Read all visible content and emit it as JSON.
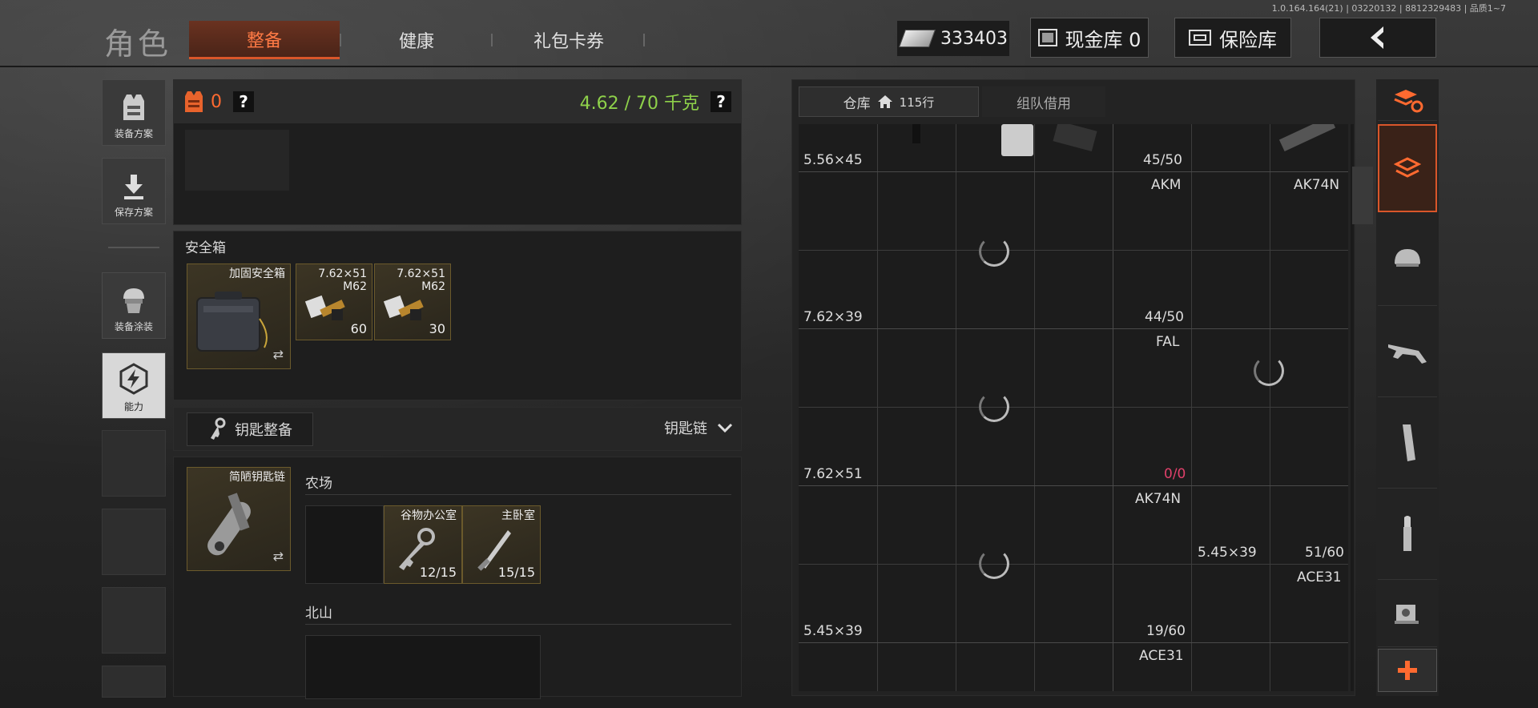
{
  "version": "1.0.164.164(21) | 03220132 | 8812329483 | 品质1~7",
  "header": {
    "title": "角色",
    "tabs": [
      "整备",
      "健康",
      "礼包卡券"
    ],
    "money": "333403",
    "cash_vault": "现金库 0",
    "safe_vault": "保险库"
  },
  "left_menu": {
    "loadout_plan": "装备方案",
    "save_plan": "保存方案",
    "skin": "装备涂装",
    "ability": "能力"
  },
  "loadout": {
    "armor_count": "0",
    "weight": "4.62 / 70 千克",
    "help": "?"
  },
  "safebox": {
    "title": "安全箱",
    "container_name": "加固安全箱",
    "items": [
      {
        "caliber": "7.62×51",
        "type": "M62",
        "count": "60"
      },
      {
        "caliber": "7.62×51",
        "type": "M62",
        "count": "30"
      }
    ]
  },
  "keys": {
    "button": "钥匙整备",
    "dropdown": "钥匙链",
    "chain_name": "简陋钥匙链",
    "sections": [
      {
        "name": "农场",
        "keys": [
          {
            "name": "谷物办公室",
            "count": "12/15"
          },
          {
            "name": "主卧室",
            "count": "15/15"
          }
        ]
      },
      {
        "name": "北山",
        "keys": []
      }
    ]
  },
  "warehouse": {
    "tab_storage": "仓库",
    "rows": "115行",
    "tab_team": "组队借用",
    "labels": [
      {
        "text": "5.56×45"
      },
      {
        "text": "45/50"
      },
      {
        "text": "AKM"
      },
      {
        "text": "AK74N"
      },
      {
        "text": "7.62×39"
      },
      {
        "text": "44/50"
      },
      {
        "text": "FAL"
      },
      {
        "text": "7.62×51"
      },
      {
        "text": "0/0"
      },
      {
        "text": "AK74N"
      },
      {
        "text": "5.45×39"
      },
      {
        "text": "51/60"
      },
      {
        "text": "ACE31"
      },
      {
        "text": "5.45×39"
      },
      {
        "text": "19/60"
      },
      {
        "text": "ACE31"
      }
    ]
  },
  "sidebar_icons": [
    "layers-refresh-icon",
    "stack-icon",
    "helmet-icon",
    "rifle-icon",
    "magazine-icon",
    "bullet-icon",
    "scope-icon",
    "plus-icon"
  ],
  "colors": {
    "accent": "#ff6a30",
    "weight": "#8ed14a",
    "zero": "#e0406a"
  }
}
